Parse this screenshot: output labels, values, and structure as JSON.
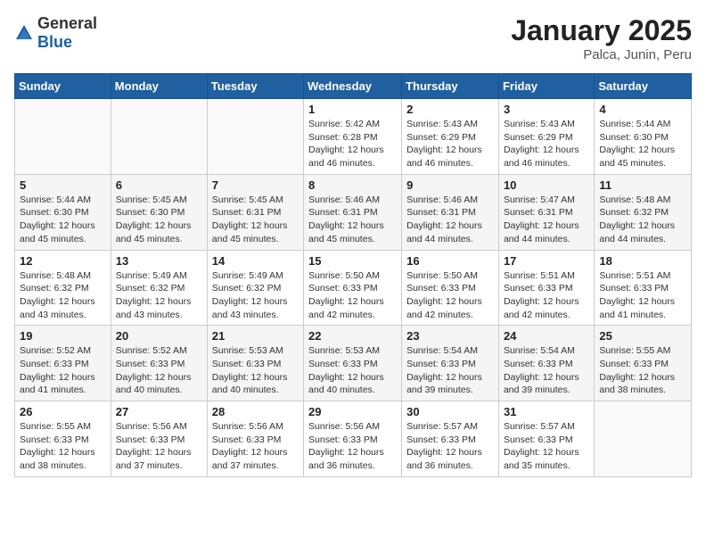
{
  "header": {
    "logo_general": "General",
    "logo_blue": "Blue",
    "title": "January 2025",
    "location": "Palca, Junin, Peru"
  },
  "weekdays": [
    "Sunday",
    "Monday",
    "Tuesday",
    "Wednesday",
    "Thursday",
    "Friday",
    "Saturday"
  ],
  "weeks": [
    [
      {
        "day": "",
        "info": ""
      },
      {
        "day": "",
        "info": ""
      },
      {
        "day": "",
        "info": ""
      },
      {
        "day": "1",
        "info": "Sunrise: 5:42 AM\nSunset: 6:28 PM\nDaylight: 12 hours\nand 46 minutes."
      },
      {
        "day": "2",
        "info": "Sunrise: 5:43 AM\nSunset: 6:29 PM\nDaylight: 12 hours\nand 46 minutes."
      },
      {
        "day": "3",
        "info": "Sunrise: 5:43 AM\nSunset: 6:29 PM\nDaylight: 12 hours\nand 46 minutes."
      },
      {
        "day": "4",
        "info": "Sunrise: 5:44 AM\nSunset: 6:30 PM\nDaylight: 12 hours\nand 45 minutes."
      }
    ],
    [
      {
        "day": "5",
        "info": "Sunrise: 5:44 AM\nSunset: 6:30 PM\nDaylight: 12 hours\nand 45 minutes."
      },
      {
        "day": "6",
        "info": "Sunrise: 5:45 AM\nSunset: 6:30 PM\nDaylight: 12 hours\nand 45 minutes."
      },
      {
        "day": "7",
        "info": "Sunrise: 5:45 AM\nSunset: 6:31 PM\nDaylight: 12 hours\nand 45 minutes."
      },
      {
        "day": "8",
        "info": "Sunrise: 5:46 AM\nSunset: 6:31 PM\nDaylight: 12 hours\nand 45 minutes."
      },
      {
        "day": "9",
        "info": "Sunrise: 5:46 AM\nSunset: 6:31 PM\nDaylight: 12 hours\nand 44 minutes."
      },
      {
        "day": "10",
        "info": "Sunrise: 5:47 AM\nSunset: 6:31 PM\nDaylight: 12 hours\nand 44 minutes."
      },
      {
        "day": "11",
        "info": "Sunrise: 5:48 AM\nSunset: 6:32 PM\nDaylight: 12 hours\nand 44 minutes."
      }
    ],
    [
      {
        "day": "12",
        "info": "Sunrise: 5:48 AM\nSunset: 6:32 PM\nDaylight: 12 hours\nand 43 minutes."
      },
      {
        "day": "13",
        "info": "Sunrise: 5:49 AM\nSunset: 6:32 PM\nDaylight: 12 hours\nand 43 minutes."
      },
      {
        "day": "14",
        "info": "Sunrise: 5:49 AM\nSunset: 6:32 PM\nDaylight: 12 hours\nand 43 minutes."
      },
      {
        "day": "15",
        "info": "Sunrise: 5:50 AM\nSunset: 6:33 PM\nDaylight: 12 hours\nand 42 minutes."
      },
      {
        "day": "16",
        "info": "Sunrise: 5:50 AM\nSunset: 6:33 PM\nDaylight: 12 hours\nand 42 minutes."
      },
      {
        "day": "17",
        "info": "Sunrise: 5:51 AM\nSunset: 6:33 PM\nDaylight: 12 hours\nand 42 minutes."
      },
      {
        "day": "18",
        "info": "Sunrise: 5:51 AM\nSunset: 6:33 PM\nDaylight: 12 hours\nand 41 minutes."
      }
    ],
    [
      {
        "day": "19",
        "info": "Sunrise: 5:52 AM\nSunset: 6:33 PM\nDaylight: 12 hours\nand 41 minutes."
      },
      {
        "day": "20",
        "info": "Sunrise: 5:52 AM\nSunset: 6:33 PM\nDaylight: 12 hours\nand 40 minutes."
      },
      {
        "day": "21",
        "info": "Sunrise: 5:53 AM\nSunset: 6:33 PM\nDaylight: 12 hours\nand 40 minutes."
      },
      {
        "day": "22",
        "info": "Sunrise: 5:53 AM\nSunset: 6:33 PM\nDaylight: 12 hours\nand 40 minutes."
      },
      {
        "day": "23",
        "info": "Sunrise: 5:54 AM\nSunset: 6:33 PM\nDaylight: 12 hours\nand 39 minutes."
      },
      {
        "day": "24",
        "info": "Sunrise: 5:54 AM\nSunset: 6:33 PM\nDaylight: 12 hours\nand 39 minutes."
      },
      {
        "day": "25",
        "info": "Sunrise: 5:55 AM\nSunset: 6:33 PM\nDaylight: 12 hours\nand 38 minutes."
      }
    ],
    [
      {
        "day": "26",
        "info": "Sunrise: 5:55 AM\nSunset: 6:33 PM\nDaylight: 12 hours\nand 38 minutes."
      },
      {
        "day": "27",
        "info": "Sunrise: 5:56 AM\nSunset: 6:33 PM\nDaylight: 12 hours\nand 37 minutes."
      },
      {
        "day": "28",
        "info": "Sunrise: 5:56 AM\nSunset: 6:33 PM\nDaylight: 12 hours\nand 37 minutes."
      },
      {
        "day": "29",
        "info": "Sunrise: 5:56 AM\nSunset: 6:33 PM\nDaylight: 12 hours\nand 36 minutes."
      },
      {
        "day": "30",
        "info": "Sunrise: 5:57 AM\nSunset: 6:33 PM\nDaylight: 12 hours\nand 36 minutes."
      },
      {
        "day": "31",
        "info": "Sunrise: 5:57 AM\nSunset: 6:33 PM\nDaylight: 12 hours\nand 35 minutes."
      },
      {
        "day": "",
        "info": ""
      }
    ]
  ]
}
